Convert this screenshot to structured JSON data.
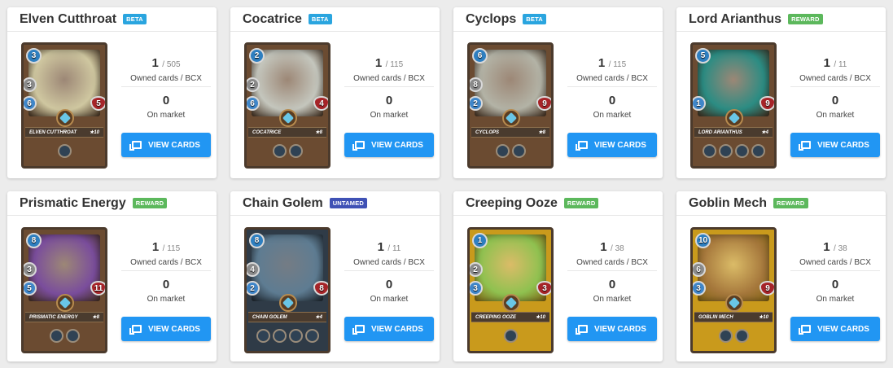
{
  "labels": {
    "owned": "Owned cards / BCX",
    "market": "On market",
    "button": "VIEW CARDS"
  },
  "colors": {
    "beta": "#2aa5df",
    "reward": "#5cb85c",
    "untamed": "#3f51b5",
    "button": "#2196f3"
  },
  "cards": [
    {
      "name": "Elven Cutthroat",
      "badge": "BETA",
      "badge_type": "beta",
      "owned": "1",
      "bcx": "/ 505",
      "market": "0",
      "mana": "3",
      "attack": "3",
      "speed": "6",
      "health": "5",
      "level": "★10",
      "frame": "#6b4b31",
      "art": "#cfc7a0",
      "abilities": 1
    },
    {
      "name": "Cocatrice",
      "badge": "BETA",
      "badge_type": "beta",
      "owned": "1",
      "bcx": "/ 115",
      "market": "0",
      "mana": "2",
      "attack": "2",
      "speed": "6",
      "health": "4",
      "level": "★8",
      "frame": "#6b4b31",
      "art": "#c4c6bd",
      "abilities": 2
    },
    {
      "name": "Cyclops",
      "badge": "BETA",
      "badge_type": "beta",
      "owned": "1",
      "bcx": "/ 115",
      "market": "0",
      "mana": "6",
      "attack": "8",
      "speed": "2",
      "health": "9",
      "level": "★8",
      "frame": "#6b4b31",
      "art": "#b3b3a6",
      "abilities": 2
    },
    {
      "name": "Lord Arianthus",
      "badge": "REWARD",
      "badge_type": "reward",
      "owned": "1",
      "bcx": "/ 11",
      "market": "0",
      "mana": "5",
      "attack": "",
      "speed": "1",
      "health": "9",
      "level": "★4",
      "frame": "#6b4b31",
      "art": "#2b8c83",
      "abilities": 4
    },
    {
      "name": "Prismatic Energy",
      "badge": "REWARD",
      "badge_type": "reward",
      "owned": "1",
      "bcx": "/ 115",
      "market": "0",
      "mana": "8",
      "attack": "3",
      "speed": "5",
      "health": "11",
      "level": "★8",
      "frame": "#6b4b31",
      "art": "#7a4d9c",
      "abilities": 2
    },
    {
      "name": "Chain Golem",
      "badge": "UNTAMED",
      "badge_type": "untamed",
      "owned": "1",
      "bcx": "/ 11",
      "market": "0",
      "mana": "8",
      "attack": "4",
      "speed": "2",
      "health": "8",
      "level": "★4",
      "frame": "#2f3b47",
      "art": "#5e7c92",
      "abilities": 4
    },
    {
      "name": "Creeping Ooze",
      "badge": "REWARD",
      "badge_type": "reward",
      "owned": "1",
      "bcx": "/ 38",
      "market": "0",
      "mana": "1",
      "attack": "2",
      "speed": "3",
      "health": "3",
      "level": "★10",
      "frame": "#c99a1c",
      "art": "#8fc150",
      "abilities": 1
    },
    {
      "name": "Goblin Mech",
      "badge": "REWARD",
      "badge_type": "reward",
      "owned": "1",
      "bcx": "/ 38",
      "market": "0",
      "mana": "10",
      "attack": "6",
      "speed": "3",
      "health": "9",
      "level": "★10",
      "frame": "#c99a1c",
      "art": "#a6783c",
      "abilities": 2
    }
  ]
}
